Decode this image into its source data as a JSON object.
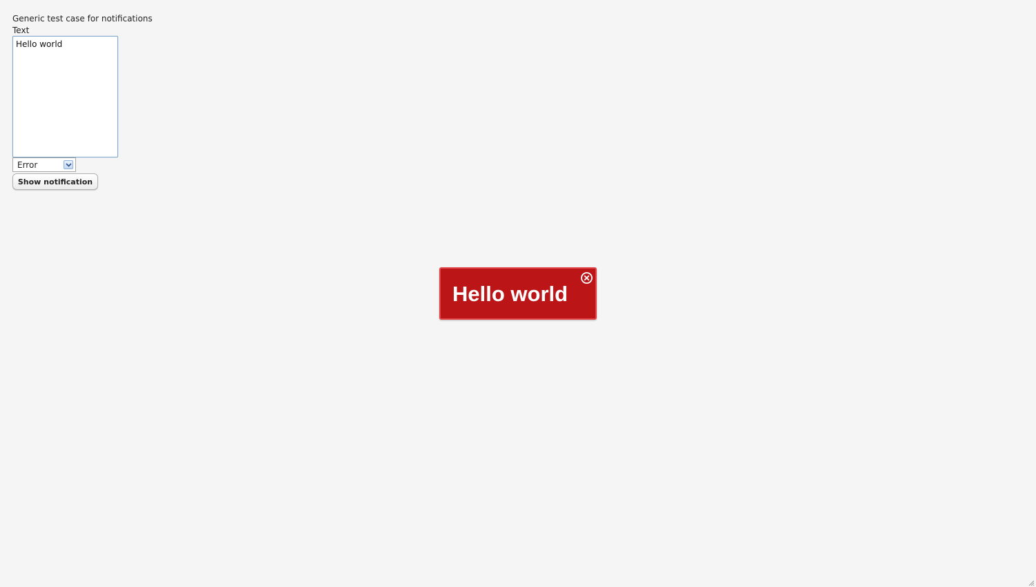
{
  "page": {
    "title": "Generic test case for notifications"
  },
  "form": {
    "text_label": "Text",
    "text_value": "Hello world",
    "type_select": {
      "selected": "Error"
    },
    "show_button_label": "Show notification"
  },
  "notification": {
    "message": "Hello world",
    "type": "Error",
    "background_color": "#bb1518",
    "border_color": "#e2474c",
    "close_icon": "close-circle-icon"
  }
}
